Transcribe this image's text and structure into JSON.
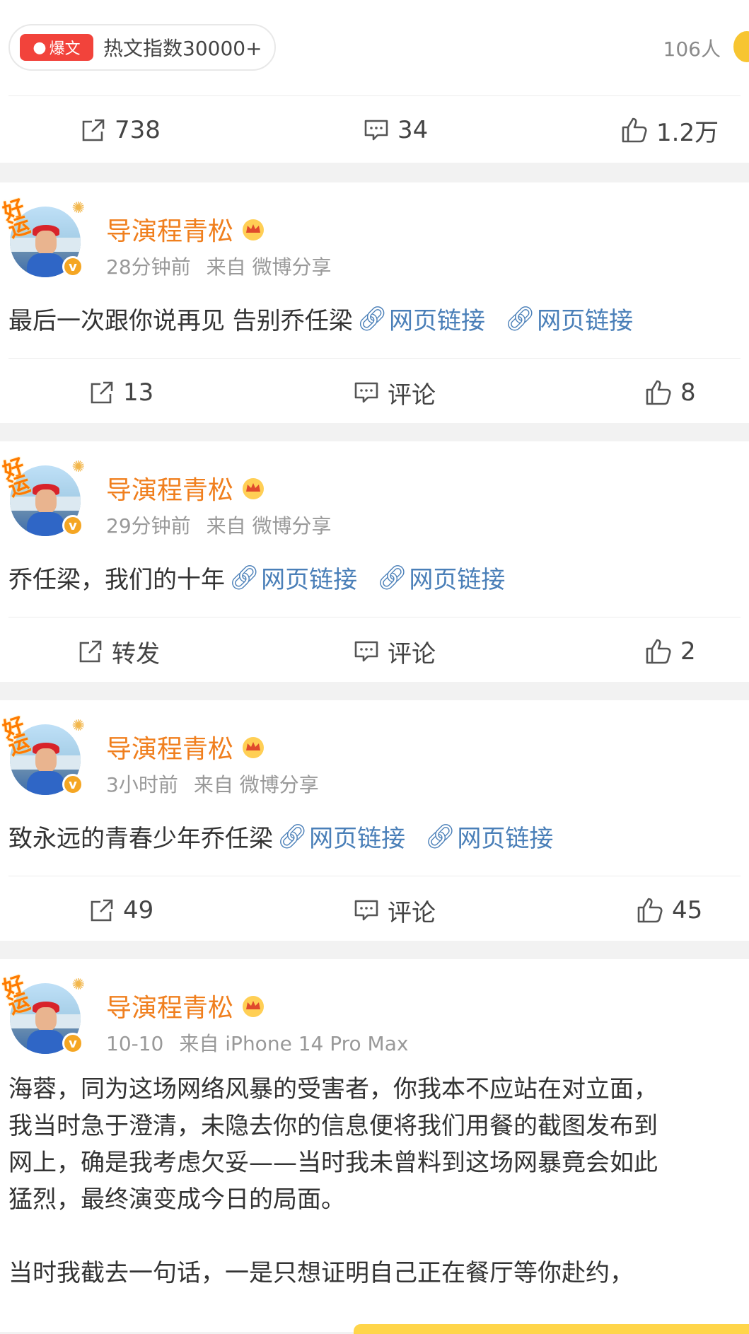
{
  "top_card": {
    "hot_badge_label": "爆文",
    "hot_index_text": "热文指数30000+",
    "readers": "106人",
    "actions": {
      "repost": "738",
      "comment": "34",
      "like": "1.2万"
    }
  },
  "posts": [
    {
      "author": "导演程青松",
      "time": "28分钟前",
      "source": "来自 微博分享",
      "text": "最后一次跟你说再见 告别乔任梁",
      "links": [
        "网页链接",
        "网页链接"
      ],
      "actions": {
        "repost": "13",
        "comment": "评论",
        "like": "8"
      }
    },
    {
      "author": "导演程青松",
      "time": "29分钟前",
      "source": "来自 微博分享",
      "text": "乔任梁，我们的十年",
      "links": [
        "网页链接",
        "网页链接"
      ],
      "actions": {
        "repost": "转发",
        "comment": "评论",
        "like": "2"
      }
    },
    {
      "author": "导演程青松",
      "time": "3小时前",
      "source": "来自 微博分享",
      "text": "致永远的青春少年乔任梁",
      "links": [
        "网页链接",
        "网页链接"
      ],
      "actions": {
        "repost": "49",
        "comment": "评论",
        "like": "45"
      }
    },
    {
      "author": "导演程青松",
      "time": "10-10",
      "source": "来自 iPhone 14 Pro Max",
      "lines": [
        "海蓉，同为这场网络风暴的受害者，你我本不应站在对立面，",
        "我当时急于澄清，未隐去你的信息便将我们用餐的截图发布到",
        "网上，确是我考虑欠妥——当时我未曾料到这场网暴竟会如此",
        "猛烈，最终演变成今日的局面。",
        "",
        "当时我截去一句话，一是只想证明自己正在餐厅等你赴约，"
      ]
    }
  ],
  "avatar_sticker": "好运",
  "verified_mark": "v",
  "colors": {
    "author": "#f07f1e",
    "link": "#4a7fb8",
    "hot_badge": "#f2433b",
    "verified": "#f5a623"
  },
  "icons": [
    "repost-icon",
    "comment-icon",
    "like-icon",
    "link-icon",
    "crown-icon",
    "verified-icon"
  ]
}
